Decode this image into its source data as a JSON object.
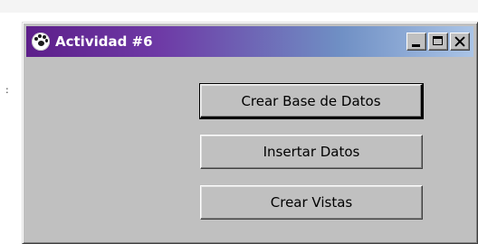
{
  "window": {
    "title": "Actividad #6",
    "title_gradient": [
      "#5d1f8a",
      "#aac4e6"
    ],
    "app_icon": "paw-icon",
    "controls": {
      "minimize_icon": "minimize-icon",
      "maximize_icon": "maximize-icon",
      "close_icon": "close-icon"
    }
  },
  "background": {
    "edge_glyph": ":"
  },
  "buttons": [
    {
      "label": "Crear Base de Datos",
      "default": true
    },
    {
      "label": "Insertar Datos",
      "default": false
    },
    {
      "label": "Crear Vistas",
      "default": false
    }
  ]
}
